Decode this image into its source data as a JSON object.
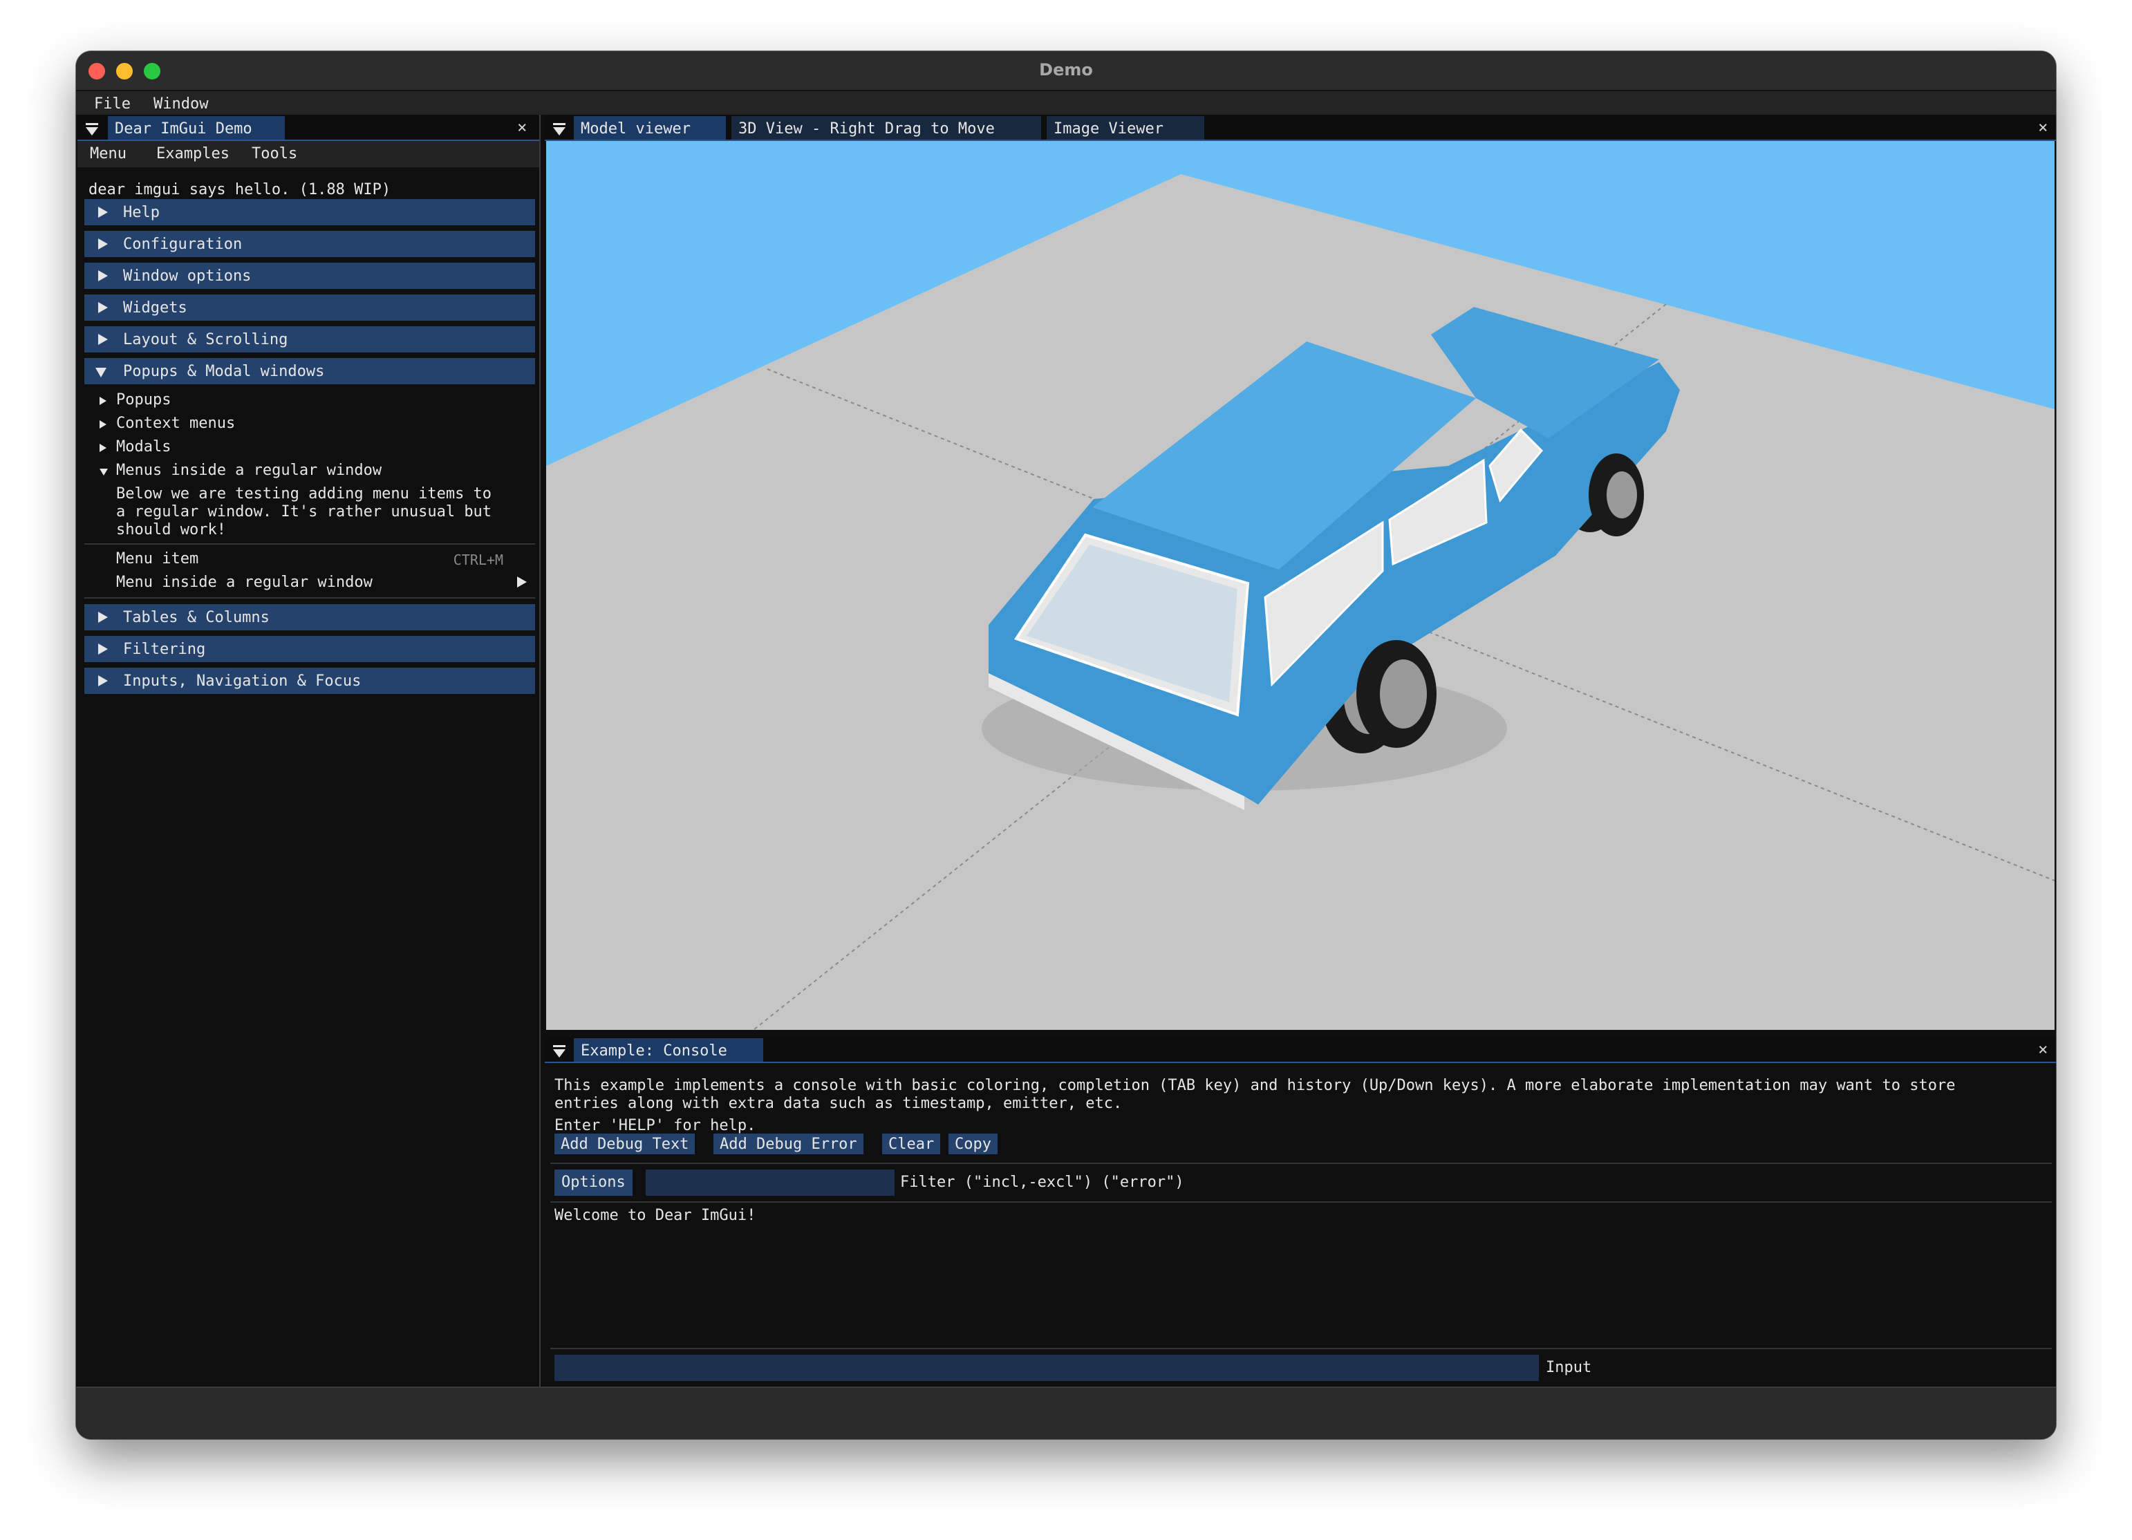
{
  "window": {
    "title": "Demo"
  },
  "main_menu": {
    "file": "File",
    "window": "Window"
  },
  "demo_window": {
    "tab_label": "Dear ImGui Demo",
    "close_glyph": "×",
    "menu": [
      "Menu",
      "Examples",
      "Tools"
    ],
    "hello_text": "dear imgui says hello. (1.88 WIP)",
    "headers": [
      {
        "label": "Help"
      },
      {
        "label": "Configuration"
      },
      {
        "label": "Window options"
      },
      {
        "label": "Widgets"
      },
      {
        "label": "Layout & Scrolling"
      },
      {
        "label": "Popups & Modal windows"
      },
      {
        "label": "Tables & Columns"
      },
      {
        "label": "Filtering"
      },
      {
        "label": "Inputs, Navigation & Focus"
      }
    ],
    "popups_nodes": [
      "Popups",
      "Context menus",
      "Modals",
      "Menus inside a regular window"
    ],
    "paragraph_lines": [
      "Below we are testing adding menu items to",
      "a regular window. It's rather unusual but",
      "should work!"
    ],
    "menu_item": "Menu item",
    "menu_item_shortcut": "CTRL+M",
    "submenu_item": "Menu inside a regular window"
  },
  "viewer_tabs": {
    "tabs": [
      "Model viewer",
      "3D View - Right Drag to Move",
      "Image Viewer"
    ],
    "close_glyph": "×"
  },
  "console": {
    "tab_label": "Example: Console",
    "close_glyph": "×",
    "description_lines": [
      "This example implements a console with basic coloring, completion (TAB key) and history (Up/Down keys). A more elaborate implementation may want to store",
      "entries along with extra data such as timestamp, emitter, etc."
    ],
    "help_text": "Enter 'HELP' for help.",
    "buttons": [
      "Add Debug Text",
      "Add Debug Error",
      "Clear",
      "Copy"
    ],
    "options_label": "Options",
    "filter_value": "",
    "filter_label": "Filter (\"incl,-excl\") (\"error\")",
    "log": [
      "Welcome to Dear ImGui!"
    ],
    "input_value": "",
    "input_label": "Input"
  },
  "colors": {
    "sky": "#6bbff7",
    "ground": "#c6c6c6",
    "car_body": "#4aa3dc",
    "header_bg": "#24426b",
    "active_tab": "#1b3b66"
  }
}
